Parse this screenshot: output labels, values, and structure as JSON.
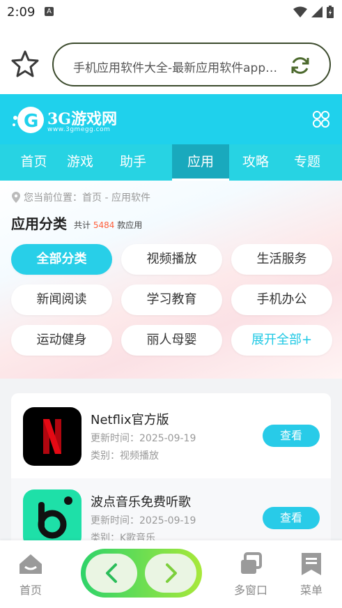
{
  "status_bar": {
    "time": "2:09",
    "notif_letter": "A"
  },
  "browser": {
    "url_text": "手机应用软件大全-最新应用软件app下载"
  },
  "site": {
    "logo_text": "3G游戏网",
    "logo_sub": "www.3gmegg.com"
  },
  "nav": {
    "tabs": [
      "首页",
      "游戏",
      "助手",
      "应用",
      "攻略",
      "专题"
    ]
  },
  "category": {
    "breadcrumb": "您当前位置：首页 - 应用软件",
    "title": "应用分类",
    "count_prefix": "共计",
    "count_num": "5484",
    "count_suffix": "款应用",
    "chips": [
      "全部分类",
      "视频播放",
      "生活服务",
      "新闻阅读",
      "学习教育",
      "手机办公",
      "运动健身",
      "丽人母婴",
      "展开全部+"
    ]
  },
  "apps": [
    {
      "name": "Netflix官方版",
      "update": "更新时间：2025-09-19",
      "category": "类别：视频播放",
      "button": "查看"
    },
    {
      "name": "波点音乐免费听歌",
      "update": "更新时间：2025-09-19",
      "category": "类别：K歌音乐",
      "button": "查看"
    }
  ],
  "bottom_bar": {
    "home": "首页",
    "windows": "多窗口",
    "menu": "菜单"
  },
  "colors": {
    "accent": "#1fd1ec",
    "nav": "#27d3e3",
    "active_tab": "#19a9bd",
    "count": "#ff5e3a",
    "pill": "#2ed36a"
  }
}
